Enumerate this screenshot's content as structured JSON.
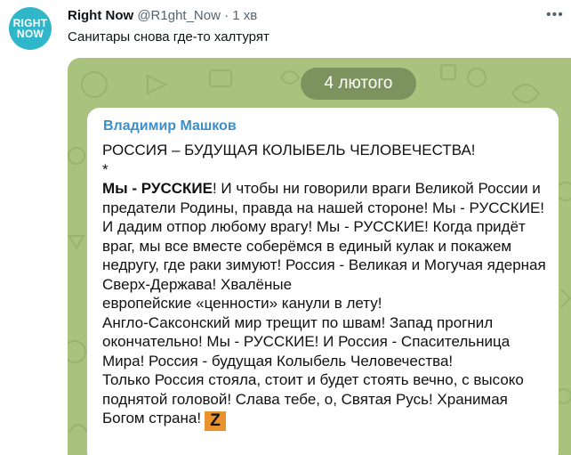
{
  "account": {
    "avatar_line1": "RIGHT",
    "avatar_line2": "NOW",
    "display_name": "Right Now",
    "handle_and_time": "@R1ght_Now · 1 хв"
  },
  "tweet": {
    "text": "Санитары снова где-то халтурят",
    "more_icon": "more-horizontal-icon"
  },
  "media": {
    "date": "4 лютого",
    "author": "Владимир Машков",
    "line1": "РОССИЯ – БУДУЩАЯ КОЛЫБЕЛЬ ЧЕЛОВЕЧЕСТВА!",
    "line2": "*",
    "bold_start": "Мы - РУССКИЕ",
    "body": "! И чтобы ни говорили враги Великой России и предатели Родины, правда на нашей стороне! Мы - РУССКИЕ! И дадим отпор любому врагу! Мы - РУССКИЕ! Когда придёт враг, мы все вместе соберёмся в единый кулак и покажем недругу, где раки зимуют! Россия - Великая и Могучая ядерная Сверх-Держава! Хвалёные\nевропейские «ценности» канули в лету!\nАнгло-Саксонский мир трещит по швам! Запад прогнил окончательно! Мы - РУССКИЕ! И Россия - Спасительница Мира! Россия - будущая Колыбель Человечества!\nТолько Россия стояла, стоит и будет стоять вечно, с высоко поднятой головой! Слава тебе, о, Святая Русь! Хранимая Богом страна!",
    "badge": "Z",
    "badge_color": "#e8932e"
  },
  "colors": {
    "avatar_bg": "#2fb6c9",
    "author_blue": "#3c8ec9",
    "chat_bg": "#a9c27e"
  }
}
